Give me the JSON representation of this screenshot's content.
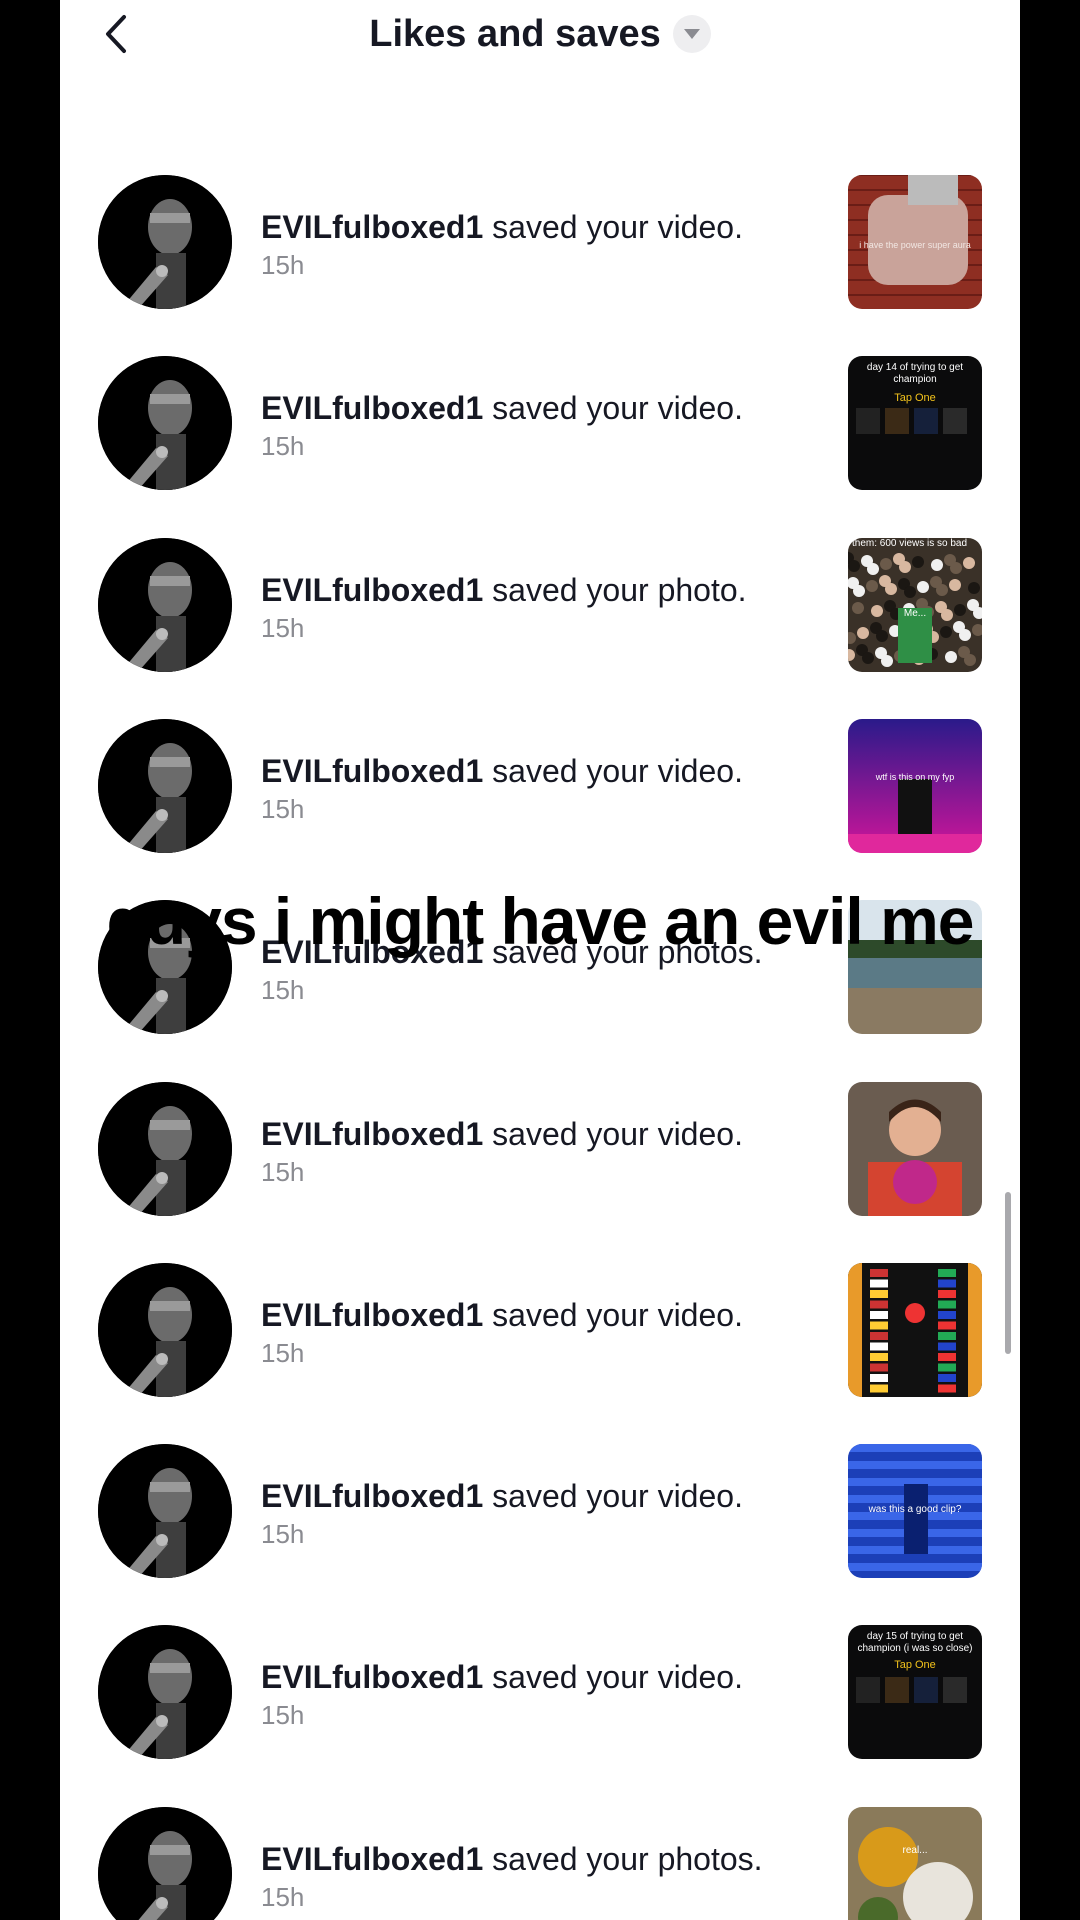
{
  "header": {
    "title": "Likes and saves",
    "back_icon": "chevron-left-icon",
    "dropdown_icon": "caret-down-icon"
  },
  "notifications": [
    {
      "user": "EVILfulboxed1",
      "action": " saved your video.",
      "time": "15h",
      "thumb": "brick-hand"
    },
    {
      "user": "EVILfulboxed1",
      "action": " saved your video.",
      "time": "15h",
      "thumb": "fortnite-14"
    },
    {
      "user": "EVILfulboxed1",
      "action": " saved your photo.",
      "time": "15h",
      "thumb": "crowd"
    },
    {
      "user": "EVILfulboxed1",
      "action": " saved your video.",
      "time": "15h",
      "thumb": "concert"
    },
    {
      "user": "EVILfulboxed1",
      "action": " saved your photos.",
      "time": "15h",
      "thumb": "lake"
    },
    {
      "user": "EVILfulboxed1",
      "action": " saved your video.",
      "time": "15h",
      "thumb": "face"
    },
    {
      "user": "EVILfulboxed1",
      "action": " saved your video.",
      "time": "15h",
      "thumb": "flags"
    },
    {
      "user": "EVILfulboxed1",
      "action": " saved your video.",
      "time": "15h",
      "thumb": "blue-stairs"
    },
    {
      "user": "EVILfulboxed1",
      "action": " saved your video.",
      "time": "15h",
      "thumb": "fortnite-15"
    },
    {
      "user": "EVILfulboxed1",
      "action": " saved your photos.",
      "time": "15h",
      "thumb": "food"
    }
  ],
  "partial_row_time": "15h",
  "thumb_captions": {
    "brick_hand": "i have the power super aura",
    "fortnite_14_title": "day 14 of trying to get champion",
    "fortnite_14_tap": "Tap One",
    "fortnite_15_title": "day 15 of trying to get champion (i was so close)",
    "fortnite_15_tap": "Tap One",
    "crowd_top": "them: 600 views is so bad",
    "crowd_me": "Me...",
    "concert": "wtf is this on my fyp",
    "blue_stairs": "was this a good clip?",
    "food": "real..."
  },
  "overlay_text": "guys i might have an evil me",
  "colors": {
    "text_primary": "#161823",
    "text_secondary": "#8a8b91",
    "background": "#ffffff",
    "scrollbar": "#a9a9ad"
  }
}
